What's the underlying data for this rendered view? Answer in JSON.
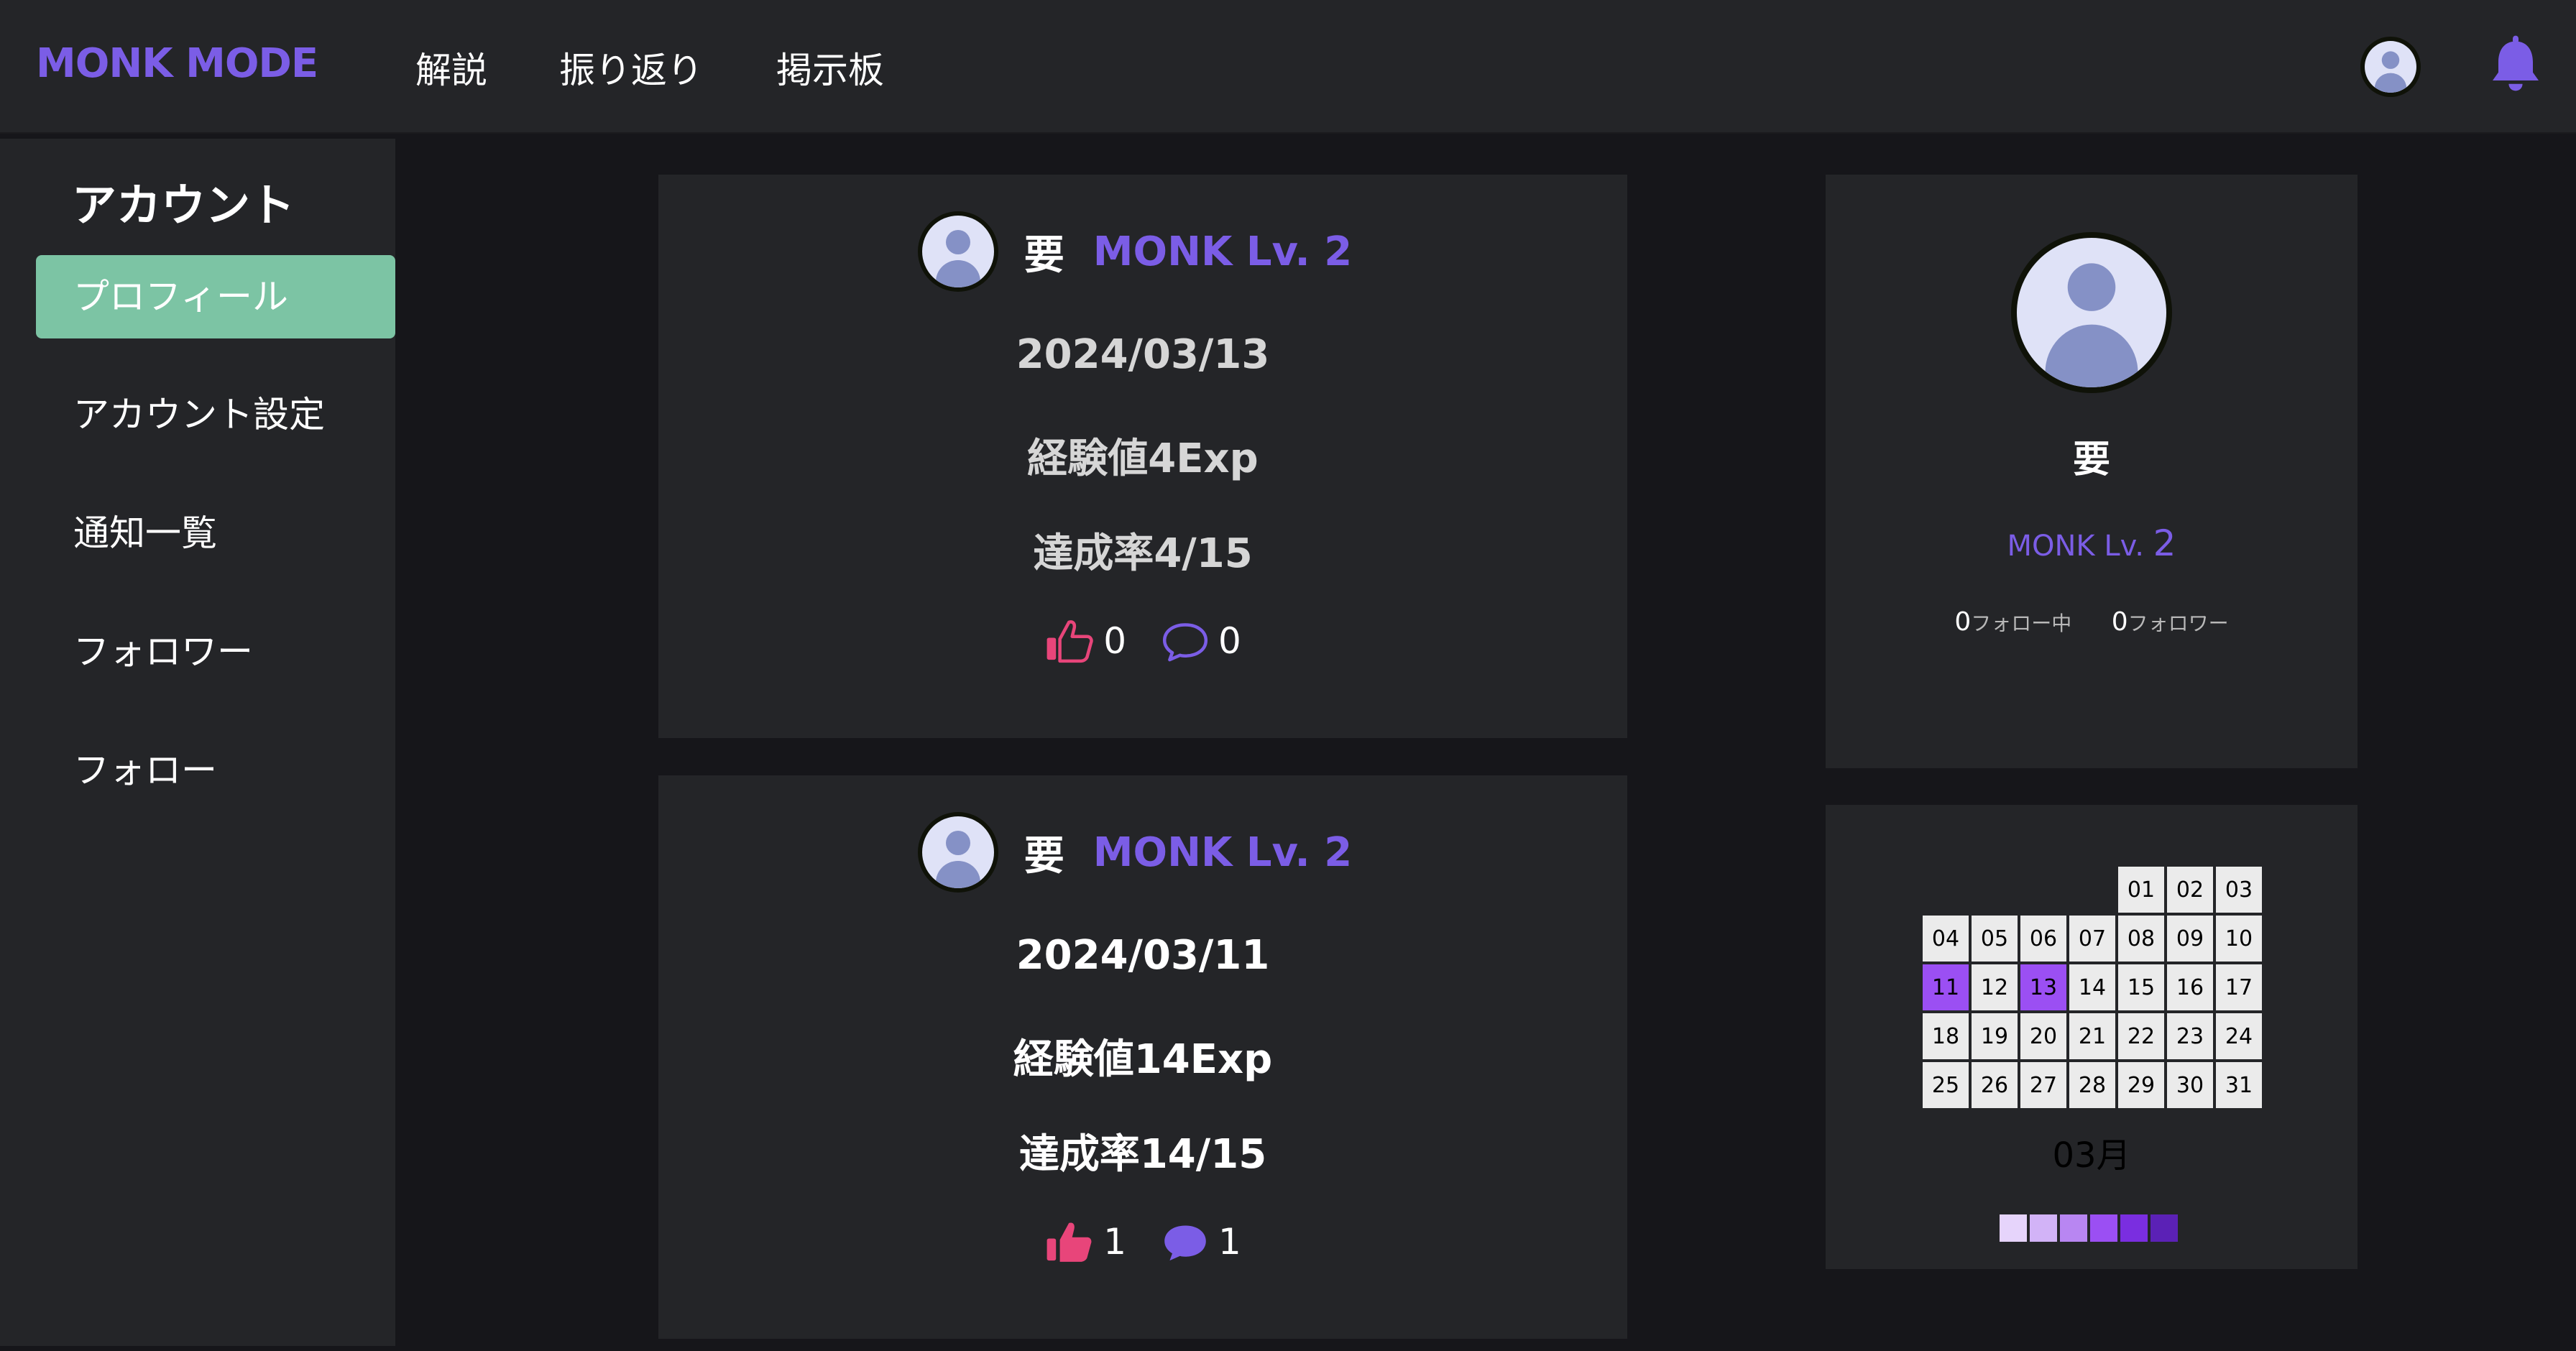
{
  "header": {
    "brand": "MONK MODE",
    "nav": [
      "解説",
      "振り返り",
      "掲示板"
    ],
    "icons": {
      "avatar": "user-avatar-icon",
      "notifications": "bell-icon"
    },
    "colors": {
      "brand": "#7b5de6",
      "bell": "#7b5de6"
    }
  },
  "sidebar": {
    "title": "アカウント",
    "items": [
      {
        "label": "プロフィール",
        "active": true
      },
      {
        "label": "アカウント設定"
      },
      {
        "label": "通知一覧"
      },
      {
        "label": "フォロワー"
      },
      {
        "label": "フォロー"
      }
    ],
    "colors": {
      "active": "#7cc4a4"
    }
  },
  "posts": [
    {
      "user": "要",
      "level": "MONK Lv. 2",
      "date": "2024/03/13",
      "exp": "経験値4Exp",
      "rate": "達成率4/15",
      "likes": "0",
      "comments": "0",
      "like_icon": "thumbs-up-outline-icon",
      "comment_icon": "comment-outline-icon"
    },
    {
      "user": "要",
      "level": "MONK Lv. 2",
      "date": "2024/03/11",
      "exp": "経験値14Exp",
      "rate": "達成率14/15",
      "likes": "1",
      "comments": "1",
      "like_icon": "thumbs-up-filled-icon",
      "comment_icon": "comment-filled-icon"
    }
  ],
  "profile": {
    "name": "要",
    "level_prefix": "MONK Lv.",
    "level_number": "2",
    "following_count": "0",
    "following_label": "フォロー中",
    "followers_count": "0",
    "followers_label": "フォロワー"
  },
  "calendar": {
    "month": "03月",
    "leading_blanks": 4,
    "days": [
      "01",
      "02",
      "03",
      "04",
      "05",
      "06",
      "07",
      "08",
      "09",
      "10",
      "11",
      "12",
      "13",
      "14",
      "15",
      "16",
      "17",
      "18",
      "19",
      "20",
      "21",
      "22",
      "23",
      "24",
      "25",
      "26",
      "27",
      "28",
      "29",
      "30",
      "31"
    ],
    "highlighted_days": [
      "11",
      "13"
    ],
    "highlight_color": "#9b4ff3",
    "legend_colors": [
      "#e6d4fb",
      "#d2b3f7",
      "#b886f2",
      "#9b4ff3",
      "#7a2ee0",
      "#5b21b6"
    ]
  },
  "colors": {
    "like": "#e8457a",
    "comment": "#7b5de6",
    "level_text": "#7b5de6"
  }
}
